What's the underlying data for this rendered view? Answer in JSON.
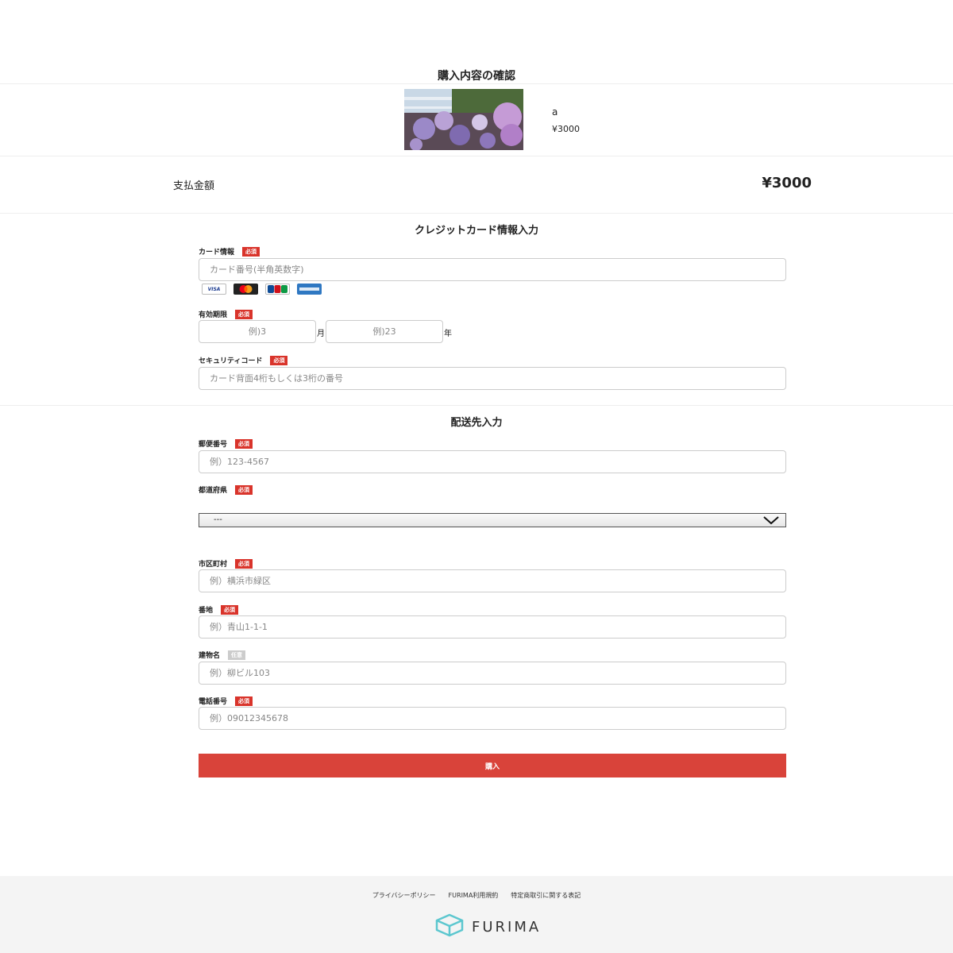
{
  "page": {
    "title": "購入内容の確認"
  },
  "product": {
    "name": "a",
    "price": "¥3000"
  },
  "total": {
    "label": "支払金額",
    "value": "¥3000"
  },
  "credit_section": {
    "title": "クレジットカード情報入力",
    "required_badge": "必須",
    "card_label": "カード情報",
    "card_placeholder": "カード番号(半角英数字)",
    "card_brands": [
      "VISA",
      "MasterCard",
      "JCB",
      "AMERICAN EXPRESS"
    ],
    "expiry_label": "有効期限",
    "month_placeholder": "例)3",
    "month_unit": "月",
    "year_placeholder": "例)23",
    "year_unit": "年",
    "cvc_label": "セキュリティコード",
    "cvc_placeholder": "カード背面4桁もしくは3桁の番号"
  },
  "shipping_section": {
    "title": "配送先入力",
    "required_badge": "必須",
    "optional_badge": "任意",
    "postal_label": "郵便番号",
    "postal_placeholder": "例）123-4567",
    "prefecture_label": "都道府県",
    "prefecture_selected": "---",
    "city_label": "市区町村",
    "city_placeholder": "例）横浜市緑区",
    "address_label": "番地",
    "address_placeholder": "例）青山1-1-1",
    "building_label": "建物名",
    "building_placeholder": "例）柳ビル103",
    "phone_label": "電話番号",
    "phone_placeholder": "例）09012345678"
  },
  "buy_button": {
    "label": "購入"
  },
  "footer": {
    "links": [
      "プライバシーポリシー",
      "FURIMA利用規約",
      "特定商取引に関する表記"
    ],
    "logo_text": "FURIMA"
  },
  "icons": {
    "chevron": "chevron-down-icon",
    "logo": "box-logo-icon"
  },
  "colors": {
    "accent": "#d9433a",
    "required_badge": "#d9342b",
    "footer_bg": "#f4f4f4",
    "logo": "#5cc7cf"
  }
}
